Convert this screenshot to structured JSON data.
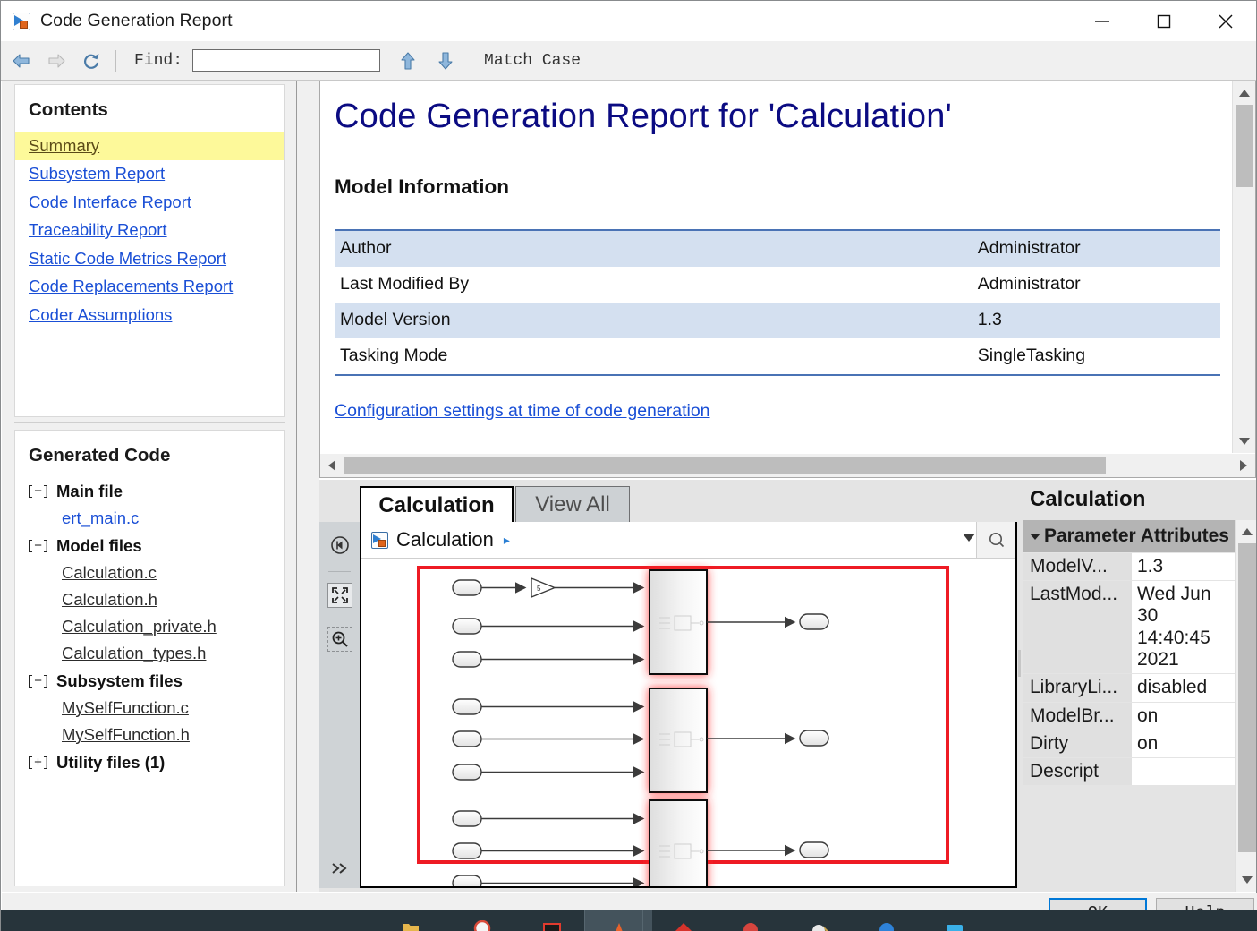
{
  "window": {
    "title": "Code Generation Report",
    "icon": "simulink-icon",
    "minimize": "minimize-icon",
    "maximize": "maximize-icon",
    "close": "close-icon"
  },
  "toolbar": {
    "back_icon": "back-arrow-icon",
    "forward_icon": "forward-arrow-icon",
    "refresh_icon": "refresh-icon",
    "find_label": "Find:",
    "find_value": "",
    "find_placeholder": "",
    "up_icon": "find-previous-icon",
    "down_icon": "find-next-icon",
    "match_case": "Match Case"
  },
  "sidebar": {
    "contents_heading": "Contents",
    "contents": [
      {
        "label": "Summary",
        "active": true
      },
      {
        "label": "Subsystem Report",
        "active": false
      },
      {
        "label": "Code Interface Report",
        "active": false
      },
      {
        "label": "Traceability Report",
        "active": false
      },
      {
        "label": "Static Code Metrics Report",
        "active": false
      },
      {
        "label": "Code Replacements Report",
        "active": false
      },
      {
        "label": "Coder Assumptions",
        "active": false
      }
    ],
    "generated_heading": "Generated Code",
    "groups": [
      {
        "toggle": "[−]",
        "label": "Main file",
        "files": [
          {
            "name": "ert_main.c",
            "blue": true
          }
        ]
      },
      {
        "toggle": "[−]",
        "label": "Model files",
        "files": [
          {
            "name": "Calculation.c",
            "blue": false
          },
          {
            "name": "Calculation.h",
            "blue": false
          },
          {
            "name": "Calculation_private.h",
            "blue": false
          },
          {
            "name": "Calculation_types.h",
            "blue": false
          }
        ]
      },
      {
        "toggle": "[−]",
        "label": "Subsystem files",
        "files": [
          {
            "name": "MySelfFunction.c",
            "blue": false
          },
          {
            "name": "MySelfFunction.h",
            "blue": false
          }
        ]
      },
      {
        "toggle": "[+]",
        "label": "Utility files (1)",
        "files": []
      }
    ]
  },
  "document": {
    "h1": "Code Generation Report for 'Calculation'",
    "h2": "Model Information",
    "table": [
      {
        "key": "Author",
        "value": "Administrator",
        "alt": true
      },
      {
        "key": "Last Modified By",
        "value": "Administrator",
        "alt": false
      },
      {
        "key": "Model Version",
        "value": "1.3",
        "alt": true
      },
      {
        "key": "Tasking Mode",
        "value": "SingleTasking",
        "alt": false
      }
    ],
    "config_link": "Configuration settings at time of code generation"
  },
  "bottom": {
    "tabs": [
      {
        "label": "Calculation",
        "selected": true
      },
      {
        "label": "View All",
        "selected": false
      }
    ],
    "breadcrumb": {
      "icon": "simulink-model-icon",
      "label": "Calculation",
      "separator": "▸",
      "caret": "chevron-down-icon",
      "search": "search-icon"
    },
    "tools": [
      {
        "name": "back-to-parent-icon"
      },
      {
        "name": "fit-to-view-icon"
      },
      {
        "name": "zoom-in-icon"
      },
      {
        "name": "more-tools-icon"
      }
    ],
    "gain_label": "5"
  },
  "properties": {
    "title": "Calculation",
    "section": "Parameter Attributes",
    "rows": [
      {
        "key": "ModelV...",
        "value": "1.3"
      },
      {
        "key": "LastMod...",
        "value": "Wed Jun 30 14:40:45 2021"
      },
      {
        "key": "LibraryLi...",
        "value": "disabled"
      },
      {
        "key": "ModelBr...",
        "value": "on"
      },
      {
        "key": "Dirty",
        "value": "on"
      },
      {
        "key": "Descript",
        "value": ""
      }
    ]
  },
  "dialog": {
    "ok": "OK",
    "help": "Help"
  },
  "colors": {
    "title_link": "#0b0b82",
    "link": "#1a4fd6",
    "highlight": "#fdf99a",
    "table_alt": "#d4e0f0",
    "table_border": "#4a73b5",
    "red_box": "#ee1b24",
    "accent": "#0078d7"
  }
}
